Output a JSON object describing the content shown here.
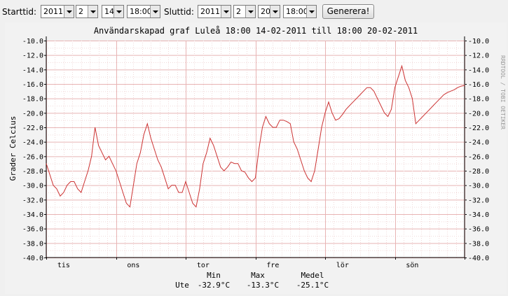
{
  "toolbar": {
    "start_label": "Starttid:",
    "start_year": "2011",
    "start_month": "2",
    "start_day": "14",
    "start_time": "18:00",
    "end_label": "Sluttid:",
    "end_year": "2011",
    "end_month": "2",
    "end_day": "20",
    "end_time": "18:00",
    "generate_label": "Generera!"
  },
  "chart_data": {
    "type": "line",
    "title": "Användarskapad graf Luleå 18:00 14-02-2011 till 18:00 20-02-2011",
    "ylabel": "Grader Celcius",
    "xlabel": "",
    "ylim": [
      -40,
      -10
    ],
    "yticks": [
      "-10.0",
      "-12.0",
      "-14.0",
      "-16.0",
      "-18.0",
      "-20.0",
      "-22.0",
      "-24.0",
      "-26.0",
      "-28.0",
      "-30.0",
      "-32.0",
      "-34.0",
      "-36.0",
      "-38.0",
      "-40.0"
    ],
    "xlim": [
      0,
      6
    ],
    "x_ticks": [
      {
        "label": "tis",
        "x": 0.25
      },
      {
        "label": "ons",
        "x": 1.25
      },
      {
        "label": "tor",
        "x": 2.25
      },
      {
        "label": "fre",
        "x": 3.25
      },
      {
        "label": "lör",
        "x": 4.25
      },
      {
        "label": "sön",
        "x": 5.25
      }
    ],
    "grid": true,
    "side_label": "RRDTOOL / TOBI OETIKER",
    "line_color": "#cc3333",
    "series": [
      {
        "x": [
          0,
          0.05,
          0.1,
          0.15,
          0.2,
          0.25,
          0.3,
          0.35,
          0.4,
          0.45,
          0.5,
          0.55,
          0.6,
          0.65,
          0.7,
          0.75,
          0.8,
          0.85,
          0.9,
          0.95,
          1,
          1.05,
          1.1,
          1.15,
          1.2,
          1.25,
          1.3,
          1.35,
          1.4,
          1.45,
          1.5,
          1.55,
          1.6,
          1.65,
          1.7,
          1.75,
          1.8,
          1.85,
          1.9,
          1.95,
          2,
          2.05,
          2.1,
          2.15,
          2.2,
          2.25,
          2.3,
          2.35,
          2.4,
          2.45,
          2.5,
          2.55,
          2.6,
          2.65,
          2.7,
          2.75,
          2.8,
          2.85,
          2.9,
          2.95,
          3,
          3.05,
          3.1,
          3.15,
          3.2,
          3.25,
          3.3,
          3.35,
          3.4,
          3.45,
          3.5,
          3.55,
          3.6,
          3.65,
          3.7,
          3.75,
          3.8,
          3.85,
          3.9,
          3.95,
          4,
          4.05,
          4.1,
          4.15,
          4.2,
          4.25,
          4.3,
          4.35,
          4.4,
          4.45,
          4.5,
          4.55,
          4.6,
          4.65,
          4.7,
          4.75,
          4.8,
          4.85,
          4.9,
          4.95,
          5,
          5.05,
          5.1,
          5.15,
          5.2,
          5.25,
          5.3,
          5.35,
          5.4,
          5.45,
          5.5,
          5.55,
          5.6,
          5.65,
          5.7,
          5.75,
          5.8,
          5.85,
          5.9,
          5.95,
          6
        ],
        "values": [
          -27.0,
          -28.5,
          -30.0,
          -30.5,
          -31.5,
          -31.0,
          -30.0,
          -29.5,
          -29.5,
          -30.5,
          -31.0,
          -29.5,
          -28.0,
          -26.0,
          -22.0,
          -24.5,
          -25.5,
          -26.5,
          -26.0,
          -27.0,
          -28.0,
          -29.5,
          -31.0,
          -32.5,
          -33.0,
          -30.0,
          -27.0,
          -25.5,
          -23.0,
          -21.5,
          -23.5,
          -25.0,
          -26.5,
          -27.5,
          -29.0,
          -30.5,
          -30.0,
          -30.0,
          -31.0,
          -31.0,
          -29.5,
          -31.0,
          -32.5,
          -33.0,
          -30.5,
          -27.0,
          -25.5,
          -23.5,
          -24.5,
          -26.0,
          -27.5,
          -28.0,
          -27.5,
          -26.8,
          -27.0,
          -27.0,
          -28.0,
          -28.2,
          -29.0,
          -29.5,
          -29.0,
          -25.0,
          -22.0,
          -20.5,
          -21.5,
          -22.0,
          -22.0,
          -21.0,
          -21.0,
          -21.2,
          -21.5,
          -24.0,
          -25.0,
          -26.5,
          -28.0,
          -29.0,
          -29.5,
          -28.0,
          -25.0,
          -22.0,
          -20.0,
          -18.5,
          -20.0,
          -21.0,
          -20.8,
          -20.2,
          -19.5,
          -19.0,
          -18.5,
          -18.0,
          -17.5,
          -17.0,
          -16.5,
          -16.5,
          -17.0,
          -18.0,
          -19.0,
          -20.0,
          -20.5,
          -19.5,
          -16.5,
          -15.0,
          -13.5,
          -15.5,
          -16.5,
          -18.0,
          -21.5,
          -21.0,
          -20.5,
          -20.0,
          -19.5,
          -19.0,
          -18.5,
          -18.0,
          -17.5,
          -17.2,
          -17.0,
          -16.8,
          -16.5,
          -16.3,
          -16.2
        ]
      }
    ],
    "stats": {
      "row_label": "Ute",
      "min_label": "Min",
      "min_value": "-32.9°C",
      "max_label": "Max",
      "max_value": "-13.3°C",
      "mean_label": "Medel",
      "mean_value": "-25.1°C"
    }
  }
}
